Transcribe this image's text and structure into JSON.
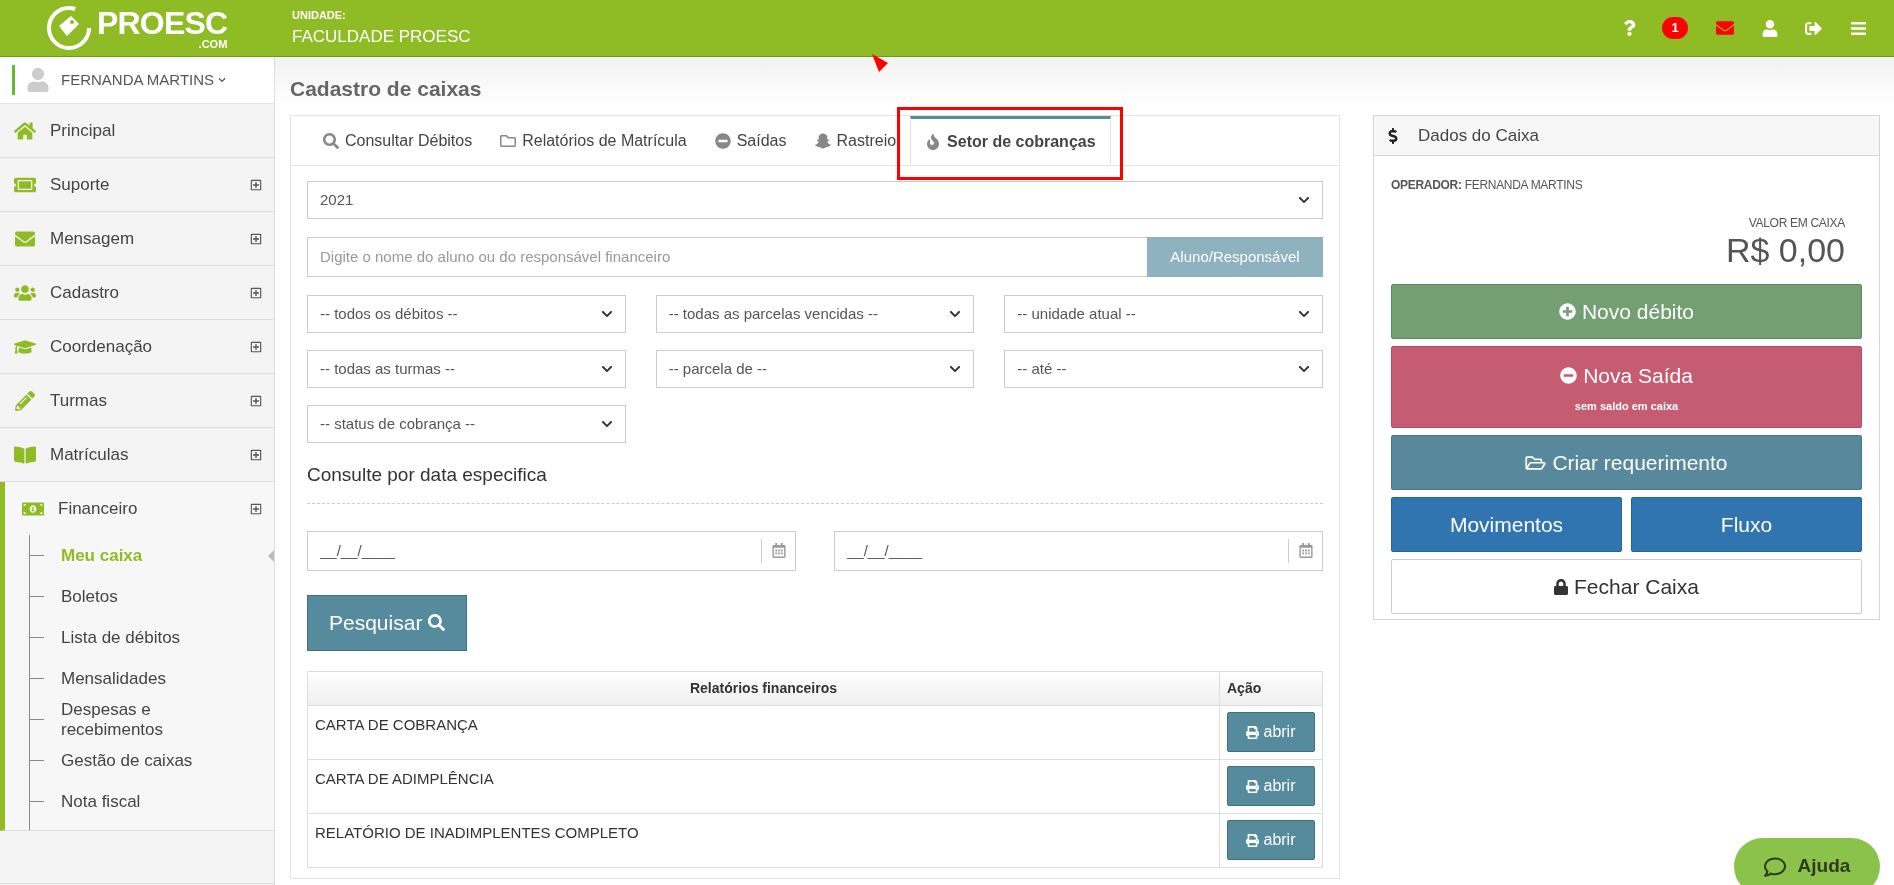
{
  "header": {
    "logo_text": "PROESC",
    "logo_sub": ".COM",
    "unit_label": "UNIDADE:",
    "unit_name": "FACULDADE PROESC",
    "notification_count": "1"
  },
  "sidebar": {
    "user": "FERNANDA MARTINS",
    "items": [
      {
        "label": "Principal",
        "expandable": false,
        "expanded": false
      },
      {
        "label": "Suporte",
        "expandable": true,
        "expanded": false
      },
      {
        "label": "Mensagem",
        "expandable": true,
        "expanded": false
      },
      {
        "label": "Cadastro",
        "expandable": true,
        "expanded": false
      },
      {
        "label": "Coordenação",
        "expandable": true,
        "expanded": false
      },
      {
        "label": "Turmas",
        "expandable": true,
        "expanded": false
      },
      {
        "label": "Matrículas",
        "expandable": true,
        "expanded": false
      },
      {
        "label": "Financeiro",
        "expandable": true,
        "expanded": true,
        "children": [
          {
            "label": "Meu caixa",
            "selected": true
          },
          {
            "label": "Boletos",
            "selected": false
          },
          {
            "label": "Lista de débitos",
            "selected": false
          },
          {
            "label": "Mensalidades",
            "selected": false
          },
          {
            "label": "Despesas e recebimentos",
            "selected": false
          },
          {
            "label": "Gestão de caixas",
            "selected": false
          },
          {
            "label": "Nota fiscal",
            "selected": false
          }
        ]
      }
    ]
  },
  "page_title": "Cadastro de caixas",
  "tabs": [
    {
      "label": "Consultar Débitos",
      "selected": false
    },
    {
      "label": "Relatórios de Matrícula",
      "selected": false
    },
    {
      "label": "Saídas",
      "selected": false
    },
    {
      "label": "Rastreio",
      "selected": false
    },
    {
      "label": "Setor de cobranças",
      "selected": true
    }
  ],
  "year_select": "2021",
  "search": {
    "placeholder": "Digite o nome do aluno ou do responsável financeiro",
    "button": "Aluno/Responsável"
  },
  "filters": [
    "-- todos os débitos --",
    "-- todas as parcelas vencidas --",
    "-- unidade atual --",
    "-- todas as turmas --",
    "-- parcela de --",
    "-- até --",
    "-- status de cobrança --"
  ],
  "date_section": {
    "heading": "Consulte por data especifica",
    "date_from_placeholder": "__/__/____",
    "date_to_placeholder": "__/__/____"
  },
  "search_button": "Pesquisar",
  "table": {
    "columns": [
      "Relatórios financeiros",
      "Ação"
    ],
    "rows": [
      {
        "name": "CARTA DE COBRANÇA",
        "action": "abrir"
      },
      {
        "name": "CARTA DE ADIMPLÊNCIA",
        "action": "abrir"
      },
      {
        "name": "RELATÓRIO DE INADIMPLENTES COMPLETO",
        "action": "abrir"
      }
    ]
  },
  "cash_panel": {
    "title": "Dados do Caixa",
    "operator_label": "OPERADOR:",
    "operator_name": "FERNANDA MARTINS",
    "value_label": "VALOR EM CAIXA",
    "value": "R$ 0,00",
    "buttons": [
      {
        "kind": "add",
        "label": "Novo débito"
      },
      {
        "kind": "withdraw",
        "label": "Nova Saída",
        "note": "sem saldo em caixa"
      },
      {
        "kind": "request",
        "label": "Criar requerimento"
      },
      {
        "kind": "pair",
        "labels": [
          "Movimentos",
          "Fluxo"
        ]
      },
      {
        "kind": "close",
        "label": "Fechar Caixa"
      }
    ]
  },
  "help_button": "Ajuda"
}
